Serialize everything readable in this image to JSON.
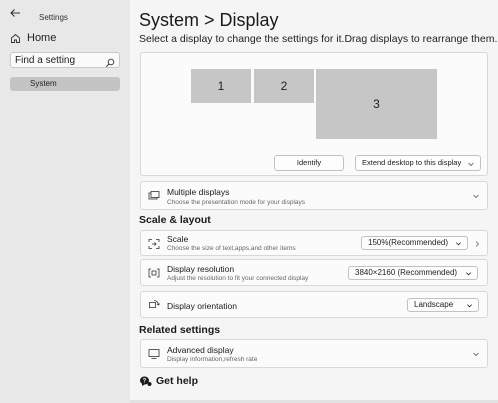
{
  "sidebar": {
    "app_title": "Settings",
    "home_label": "Home",
    "search_placeholder": "Find a setting",
    "nav_item": "System"
  },
  "header": {
    "title": "System  >  Display",
    "subtitle": "Select a display to change the settings for it.Drag displays to rearrange them."
  },
  "arrange": {
    "monitors": [
      "1",
      "2",
      "3"
    ],
    "identify_label": "Identify",
    "extend_label": "Extend desktop to this display"
  },
  "multiple_displays": {
    "title": "Multiple displays",
    "subtitle": "Choose the presentation mode for your displays"
  },
  "scale_layout": {
    "heading": "Scale & layout",
    "scale": {
      "title": "Scale",
      "subtitle": "Choose the size of text,apps,and other items",
      "value": "150%(Recommended)"
    },
    "resolution": {
      "title": "Display resolution",
      "subtitle": "Adjust the resolution to fit your connected display",
      "value": "3840×2160 (Recommended)"
    },
    "orientation": {
      "title": "Display orientation",
      "value": "Landscape"
    }
  },
  "related": {
    "heading": "Related settings",
    "advanced": {
      "title": "Advanced display",
      "subtitle": "Display information,refresh rate"
    }
  },
  "help": {
    "label": "Get help"
  },
  "colors": {
    "sidebar_bg": "#e8e8e8",
    "main_bg": "#f5f5f5",
    "monitor_fill": "#c6c6c6",
    "nav_selected": "#c4c4c4"
  }
}
